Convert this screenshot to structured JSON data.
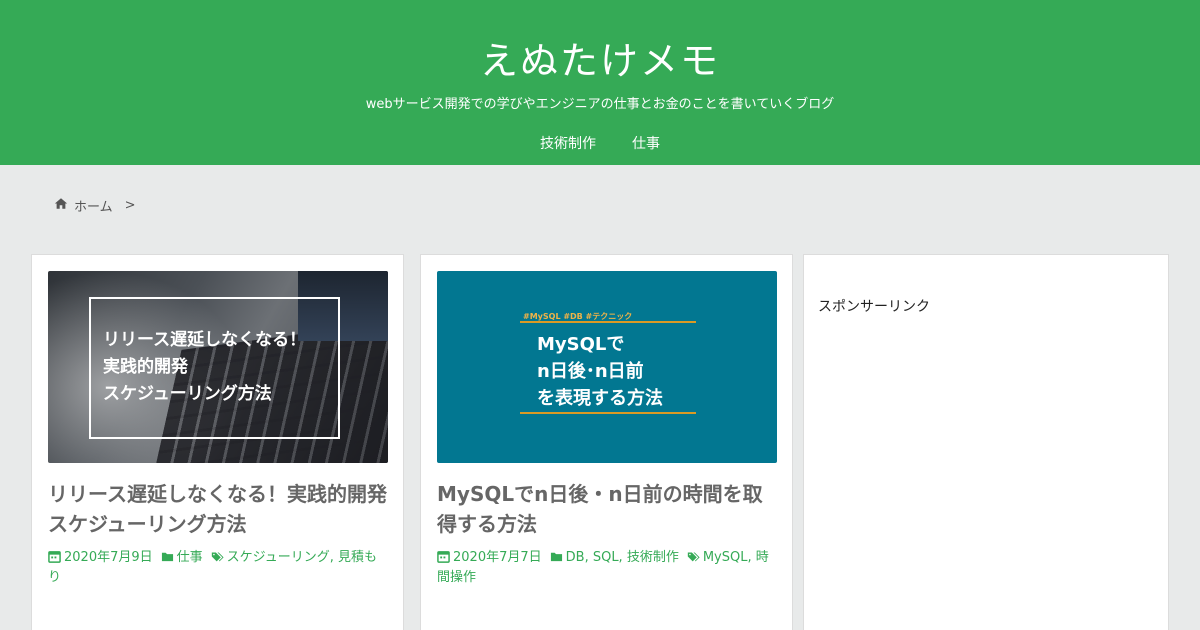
{
  "site": {
    "title": "えぬたけメモ",
    "description": "webサービス開発での学びやエンジニアの仕事とお金のことを書いていくブログ"
  },
  "nav": {
    "items": [
      {
        "label": "技術制作"
      },
      {
        "label": "仕事"
      }
    ]
  },
  "breadcrumb": {
    "home_label": "ホーム",
    "separator": ">"
  },
  "posts": [
    {
      "thumb_lines": [
        "リリース遅延しなくなる！",
        "実践的開発",
        "スケジューリング方法"
      ],
      "title": "リリース遅延しなくなる！実践的開発スケジューリング方法",
      "date": "2020年7月9日",
      "category": "仕事",
      "tags": "スケジューリング, 見積もり"
    },
    {
      "thumb_tags": "#MySQL #DB #テクニック",
      "thumb_lines": [
        "MySQLで",
        "n日後･n日前",
        "を表現する方法"
      ],
      "title": "MySQLでn日後・n日前の時間を取得する方法",
      "date": "2020年7月7日",
      "category": "DB, SQL, 技術制作",
      "tags": "MySQL, 時間操作"
    }
  ],
  "sidebar": {
    "sponsor_label": "スポンサーリンク"
  },
  "colors": {
    "brand_green": "#35aa56",
    "thumb_teal": "#027791",
    "thumb_accent": "#d99a25"
  }
}
